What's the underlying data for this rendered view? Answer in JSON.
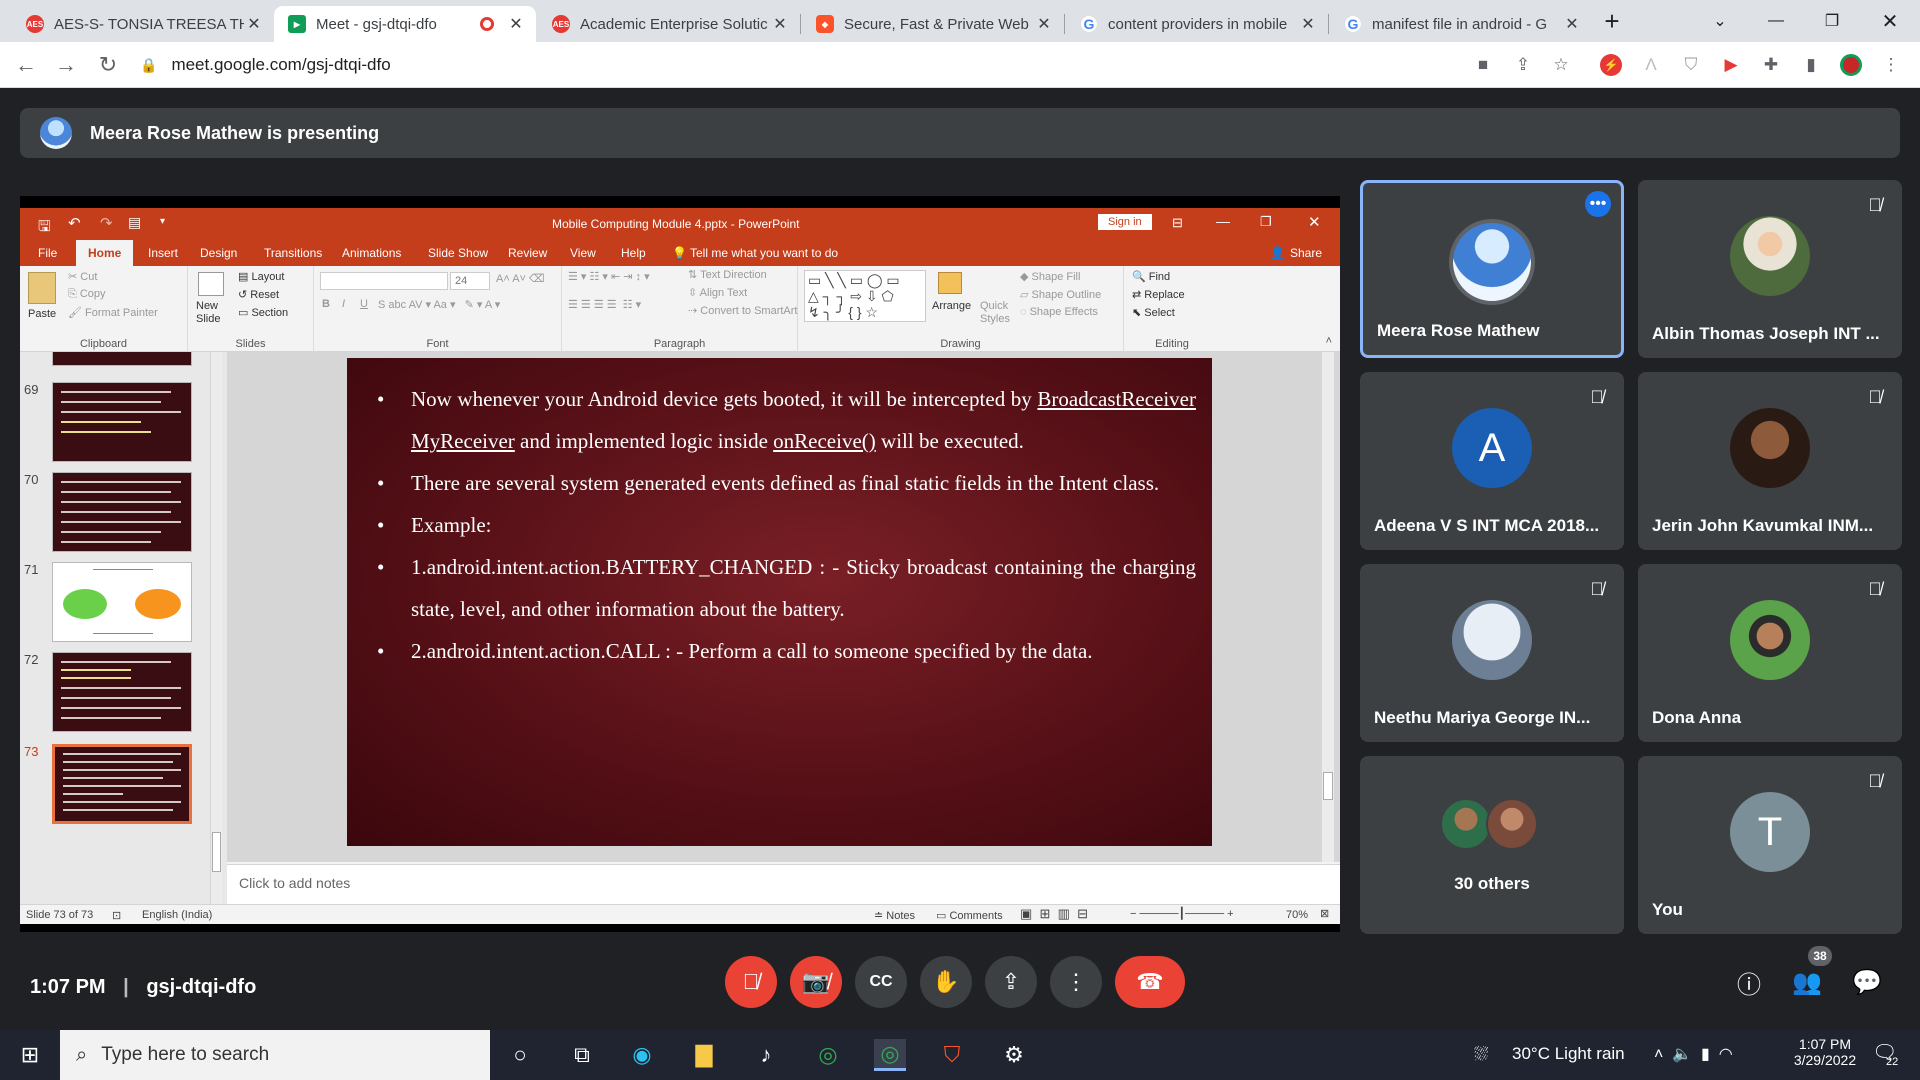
{
  "browser": {
    "tabs": [
      {
        "title": "AES-S- TONSIA TREESA TH",
        "icon": "aes-favicon",
        "active": false
      },
      {
        "title": "Meet - gsj-dtqi-dfo",
        "icon": "meet-favicon",
        "active": true
      },
      {
        "title": "Academic Enterprise Solutic",
        "icon": "aes-favicon",
        "active": false
      },
      {
        "title": "Secure, Fast & Private Web",
        "icon": "brave-favicon",
        "active": false
      },
      {
        "title": "content providers in mobile",
        "icon": "google-favicon",
        "active": false
      },
      {
        "title": "manifest file in android - G",
        "icon": "google-favicon",
        "active": false
      }
    ],
    "new_tab": "+",
    "url": "meet.google.com/gsj-dtqi-dfo"
  },
  "meet": {
    "presenting_banner": "Meera Rose Mathew is presenting",
    "participants": [
      {
        "name": "Meera Rose Mathew",
        "avatar_type": "photo-mountain",
        "muted": false,
        "active": true
      },
      {
        "name": "Albin Thomas Joseph INT ...",
        "avatar_type": "photo-person",
        "muted": true
      },
      {
        "name": "Adeena V S INT MCA 2018...",
        "avatar_letter": "A",
        "avatar_color": "#1a5fb4",
        "muted": true
      },
      {
        "name": "Jerin John Kavumkal INM...",
        "avatar_type": "photo-cartoon",
        "muted": true
      },
      {
        "name": "Neethu Mariya George IN...",
        "avatar_type": "photo-text",
        "muted": true
      },
      {
        "name": "Dona Anna",
        "avatar_type": "photo-person",
        "muted": true
      },
      {
        "name": "30 others",
        "avatar_type": "group"
      },
      {
        "name": "You",
        "avatar_letter": "T",
        "avatar_color": "#7b8f99",
        "muted": true
      }
    ],
    "time": "1:07 PM",
    "meeting_code": "gsj-dtqi-dfo",
    "people_count": "38"
  },
  "powerpoint": {
    "title": "Mobile Computing Module 4.pptx  -  PowerPoint",
    "sign_in": "Sign in",
    "menu": [
      "File",
      "Home",
      "Insert",
      "Design",
      "Transitions",
      "Animations",
      "Slide Show",
      "Review",
      "View",
      "Help"
    ],
    "tell_me": "Tell me what you want to do",
    "share": "Share",
    "ribbon": {
      "clipboard": {
        "label": "Clipboard",
        "paste": "Paste",
        "cut": "Cut",
        "copy": "Copy",
        "format_painter": "Format Painter"
      },
      "slides": {
        "label": "Slides",
        "new_slide": "New Slide",
        "layout": "Layout",
        "reset": "Reset",
        "section": "Section"
      },
      "font": {
        "label": "Font",
        "size": "24"
      },
      "paragraph": {
        "label": "Paragraph",
        "text_direction": "Text Direction",
        "align_text": "Align Text",
        "convert_smartart": "Convert to SmartArt"
      },
      "drawing": {
        "label": "Drawing",
        "arrange": "Arrange",
        "quick_styles": "Quick Styles",
        "shape_fill": "Shape Fill",
        "shape_outline": "Shape Outline",
        "shape_effects": "Shape Effects"
      },
      "editing": {
        "label": "Editing",
        "find": "Find",
        "replace": "Replace",
        "select": "Select"
      }
    },
    "thumbnails": [
      {
        "num": "69",
        "style": "dark"
      },
      {
        "num": "70",
        "style": "dark"
      },
      {
        "num": "71",
        "style": "light"
      },
      {
        "num": "72",
        "style": "dark"
      },
      {
        "num": "73",
        "style": "dark",
        "selected": true
      }
    ],
    "slide": {
      "b1_a": "Now whenever your Android device gets booted, it will be intercepted by ",
      "b1_u1": "BroadcastReceiver",
      "b1_sp": " ",
      "b1_u2": "MyReceiver",
      "b1_b": "  and implemented logic inside ",
      "b1_u3": "onReceive()",
      "b1_c": " will be executed.",
      "b2": "There are several system generated events defined as final static fields in the Intent class.",
      "b3": " Example:",
      "b4": "1.android.intent.action.BATTERY_CHANGED : - Sticky broadcast containing the charging state, level, and other information about the battery.",
      "b5": "2.android.intent.action.CALL : - Perform a call to someone specified by the data."
    },
    "notes_placeholder": "Click to add notes",
    "status": {
      "slide": "Slide 73 of 73",
      "language": "English (India)",
      "notes": "Notes",
      "comments": "Comments",
      "zoom": "70%"
    }
  },
  "taskbar": {
    "search_placeholder": "Type here to search",
    "weather": "30°C  Light rain",
    "time": "1:07 PM",
    "date": "3/29/2022",
    "notification_count": "22"
  }
}
